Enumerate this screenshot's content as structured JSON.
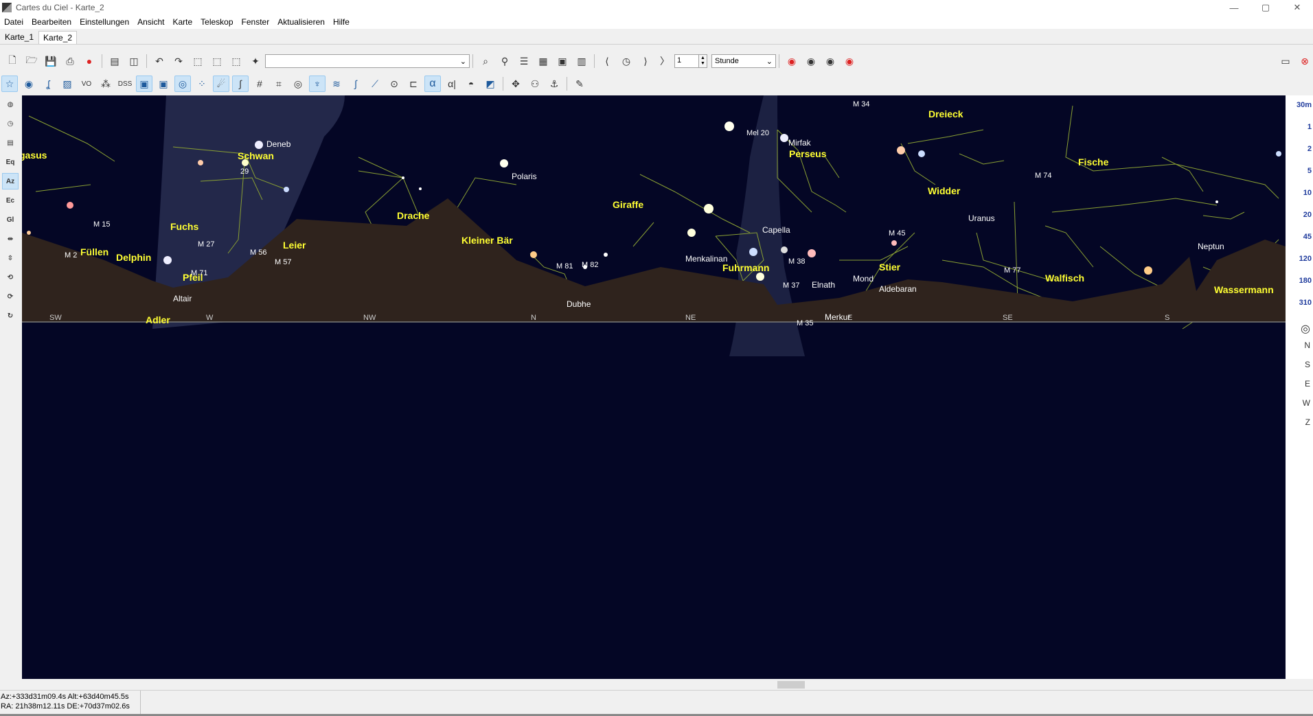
{
  "window": {
    "title": "Cartes du Ciel - Karte_2",
    "minimize": "—",
    "maximize": "▢",
    "close": "✕"
  },
  "menu": [
    "Datei",
    "Bearbeiten",
    "Einstellungen",
    "Ansicht",
    "Karte",
    "Teleskop",
    "Fenster",
    "Aktualisieren",
    "Hilfe"
  ],
  "tabs": [
    "Karte_1",
    "Karte_2"
  ],
  "active_tab": "Karte_2",
  "toolbar": {
    "search_value": "",
    "step_value": "1",
    "time_unit": "Stunde",
    "vo_label": "VO",
    "dss_label": "DSS",
    "alpha_label": "α",
    "alpha_i_label": "α|"
  },
  "left_tools": [
    "Eq",
    "Az",
    "Ec",
    "Gl"
  ],
  "right_panel": {
    "fov": [
      "30m",
      "1",
      "2",
      "5",
      "10",
      "20",
      "45",
      "120",
      "180",
      "310"
    ],
    "directions": [
      "N",
      "S",
      "E",
      "W",
      "Z"
    ]
  },
  "sky": {
    "constellations": [
      "gasus",
      "Schwan",
      "Fuchs",
      "Füllen",
      "Delphin",
      "Pfeil",
      "Adler",
      "Leier",
      "Drache",
      "Kleiner Bär",
      "Giraffe",
      "Perseus",
      "Fuhrmann",
      "Stier",
      "Dreieck",
      "Widder",
      "Fische",
      "Walfisch",
      "Wassermann"
    ],
    "stars": [
      "Deneb",
      "Polaris",
      "Altair",
      "Dubhe",
      "Capella",
      "Menkalinan",
      "Elnath",
      "Mirfak",
      "Aldebaran"
    ],
    "objects": [
      "M 15",
      "M 2",
      "M 27",
      "M 71",
      "M 56",
      "M 57",
      "M 81",
      "M 82",
      "M 38",
      "M 37",
      "M 35",
      "M 45",
      "M 34",
      "Mel 20",
      "M 74",
      "M 77",
      "29"
    ],
    "planets": [
      "Mond",
      "Merkur",
      "Uranus",
      "Neptun"
    ],
    "horizon_labels": [
      "SW",
      "W",
      "NW",
      "N",
      "NE",
      "E",
      "SE",
      "S"
    ]
  },
  "status": {
    "line1": "Az:+333d31m09.4s Alt:+63d40m45.5s",
    "line2": "RA: 21h38m12.11s DE:+70d37m02.6s"
  }
}
